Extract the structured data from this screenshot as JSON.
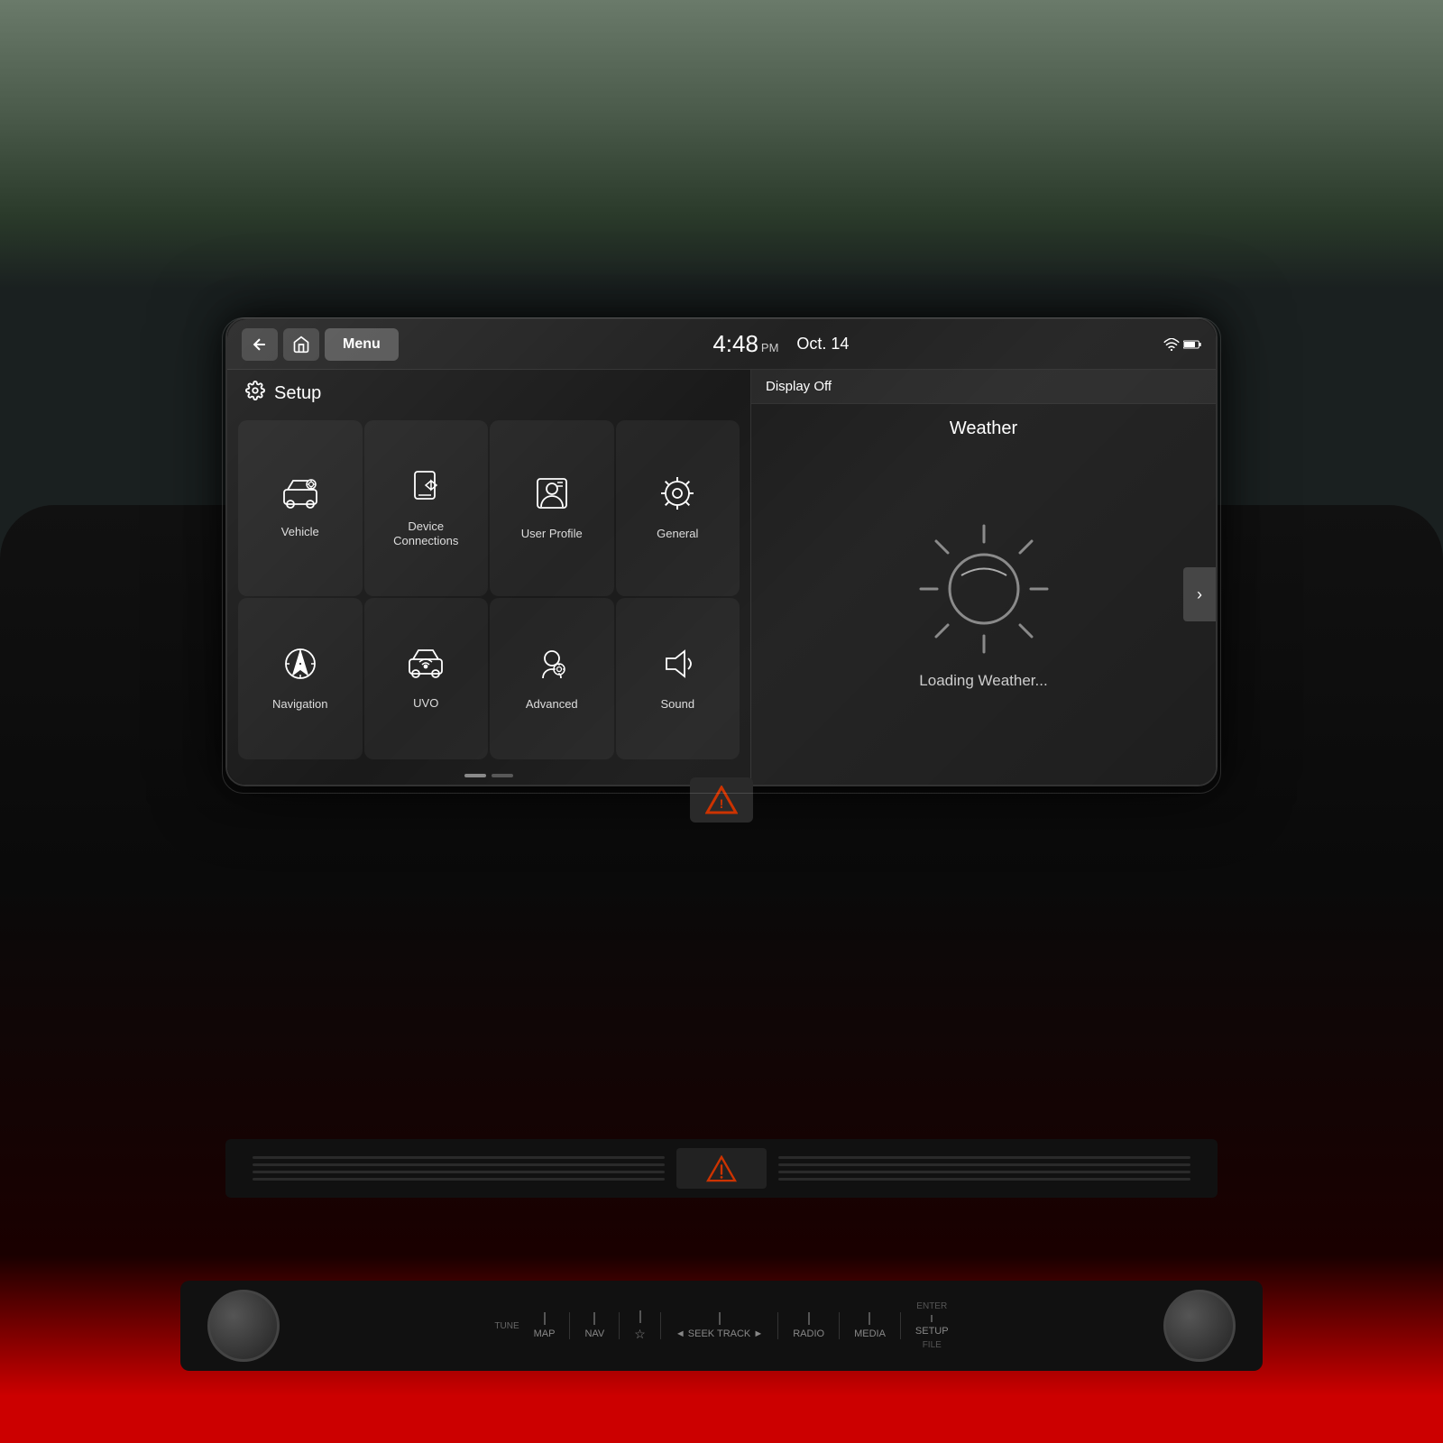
{
  "header": {
    "back_label": "←",
    "home_label": "⌂",
    "menu_label": "Menu",
    "time": "4:48",
    "ampm": "PM",
    "date": "Oct. 14",
    "setup_label": "Setup",
    "display_off_label": "Display Off"
  },
  "menu_items": [
    {
      "id": "vehicle",
      "label": "Vehicle",
      "icon": "vehicle"
    },
    {
      "id": "device-connections",
      "label": "Device\nConnections",
      "icon": "device"
    },
    {
      "id": "user-profile",
      "label": "User Profile",
      "icon": "user"
    },
    {
      "id": "general",
      "label": "General",
      "icon": "gear"
    },
    {
      "id": "navigation",
      "label": "Navigation",
      "icon": "navigation"
    },
    {
      "id": "uvo",
      "label": "UVO",
      "icon": "uvo"
    },
    {
      "id": "advanced",
      "label": "Advanced",
      "icon": "advanced"
    },
    {
      "id": "sound",
      "label": "Sound",
      "icon": "sound"
    }
  ],
  "weather": {
    "title": "Weather",
    "loading": "Loading Weather...",
    "arrow_label": "›"
  },
  "pagination": {
    "dots": [
      true,
      false
    ]
  },
  "controls": {
    "labels": [
      "MAP",
      "NAV",
      "☆",
      "◄ SEEK TRACK ►",
      "RADIO",
      "MEDIA",
      "SETUP"
    ],
    "enter_label": "ENTER",
    "file_label": "FILE",
    "tune_label": "TUNE"
  },
  "colors": {
    "accent_red": "#cc0000",
    "screen_bg": "#1a1a1a",
    "panel_bg": "#252525",
    "header_bg": "#222222",
    "icon_color": "#ffffff"
  }
}
